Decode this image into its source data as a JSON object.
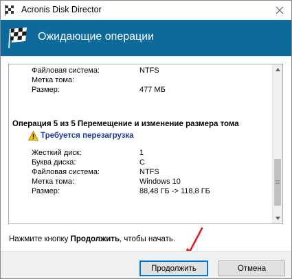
{
  "window": {
    "title": "Acronis Disk Director"
  },
  "header": {
    "title": "Ожидающие операции"
  },
  "previous_op": {
    "rows": [
      {
        "key": "Файловая система:",
        "value": "NTFS"
      },
      {
        "key": "Метка тома:",
        "value": ""
      },
      {
        "key": "Размер:",
        "value": "477 МБ"
      }
    ]
  },
  "operation": {
    "title": "Операция 5 из 5 Перемещение и изменение размера тома",
    "warning": "Требуется перезагрузка",
    "rows": [
      {
        "key": "Жесткий диск:",
        "value": "1"
      },
      {
        "key": "Буква диска:",
        "value": "C"
      },
      {
        "key": "Файловая система:",
        "value": "NTFS"
      },
      {
        "key": "Метка тома:",
        "value": "Windows 10"
      },
      {
        "key": "Размер:",
        "value": "88,48 ГБ -> 118,8 ГБ"
      }
    ]
  },
  "hint": {
    "prefix": "Нажмите кнопку ",
    "bold": "Продолжить",
    "suffix": ", чтобы начать."
  },
  "buttons": {
    "continue": "Продолжить",
    "cancel": "Отмена"
  },
  "colors": {
    "header_bg": "#0d6a9b",
    "warning_text": "#1d3a9b",
    "annotation_arrow": "#e02020"
  },
  "icons": {
    "app": "acronis-app-icon",
    "header": "checkered-flag-icon",
    "warning": "warning-triangle-icon",
    "close": "close-icon"
  }
}
